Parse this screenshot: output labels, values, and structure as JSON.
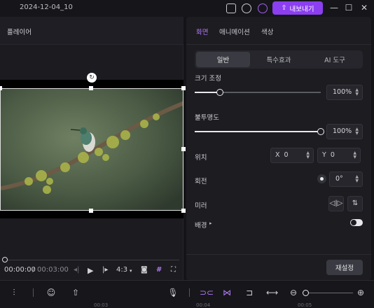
{
  "titlebar": {
    "title": "2024-12-04_10",
    "export_label": "내보내기"
  },
  "player": {
    "header": "플레이어",
    "time_current": "00:00:00",
    "time_separator": "/",
    "time_total": "00:03:00",
    "aspect": "4:3"
  },
  "panel": {
    "tabs": [
      "화면",
      "애니메이션",
      "색상"
    ],
    "segments": [
      "일반",
      "특수효과",
      "AI 도구"
    ],
    "resize_label": "크기 조정",
    "resize_value": "100%",
    "opacity_label": "불투명도",
    "opacity_value": "100%",
    "position_label": "위치",
    "pos_x_label": "X",
    "pos_x_value": "0",
    "pos_y_label": "Y",
    "pos_y_value": "0",
    "rotation_label": "회전",
    "rotation_value": "0°",
    "mirror_label": "미러",
    "background_label": "배경",
    "reset_label": "재설정"
  },
  "levels": {
    "resize_fraction": 0.2,
    "opacity_fraction": 1.0
  },
  "timeline_ruler": [
    "00:03",
    "00:04",
    "00:05"
  ],
  "colors": {
    "accent": "#8b3ff0",
    "panel_bg": "#1c1c21",
    "app_bg": "#141418"
  }
}
